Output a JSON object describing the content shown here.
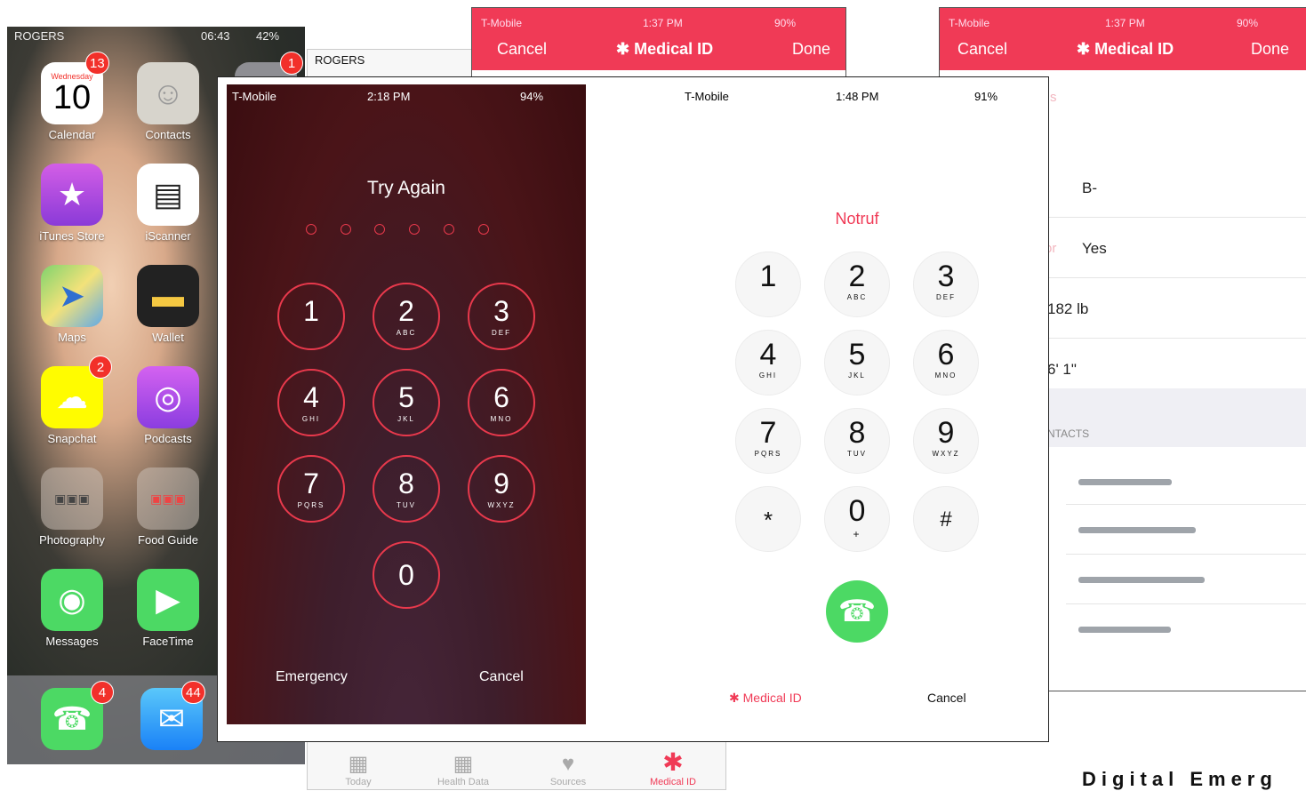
{
  "home": {
    "carrier": "ROGERS",
    "time": "06:43",
    "battery": "42%",
    "apps": [
      {
        "label": "Calendar",
        "day": "Wednesday",
        "date": "10",
        "badge": "13"
      },
      {
        "label": "Contacts",
        "badge": ""
      },
      {
        "label": "iTunes Store",
        "badge": ""
      },
      {
        "label": "iScanner",
        "badge": ""
      },
      {
        "label": "Maps",
        "badge": ""
      },
      {
        "label": "Wallet",
        "badge": ""
      },
      {
        "label": "Snapchat",
        "badge": "2"
      },
      {
        "label": "Podcasts",
        "badge": ""
      },
      {
        "label": "Photography",
        "badge": ""
      },
      {
        "label": "Food Guide",
        "badge": ""
      },
      {
        "label": "Messages",
        "badge": ""
      },
      {
        "label": "FaceTime",
        "badge": ""
      }
    ],
    "settings_badge": "1",
    "dock": [
      {
        "label": "Phone",
        "badge": "4"
      },
      {
        "label": "Mail",
        "badge": "44"
      }
    ]
  },
  "health": {
    "carrier": "ROGERS",
    "tabs": [
      "Today",
      "Health Data",
      "Sources",
      "Medical ID"
    ]
  },
  "medical_left": {
    "carrier": "T-Mobile",
    "time": "1:37 PM",
    "battery": "90%",
    "cancel": "Cancel",
    "title": "Medical ID",
    "done": "Done"
  },
  "medical_right": {
    "carrier": "T-Mobile",
    "time": "1:37 PM",
    "battery": "90%",
    "cancel": "Cancel",
    "title": "Medical ID",
    "done": "Done",
    "partial_label": "s",
    "rows": [
      {
        "label": "",
        "value": "B-"
      },
      {
        "label": "or",
        "value": "Yes"
      },
      {
        "label": "",
        "value": "182 lb"
      },
      {
        "label": "",
        "value": "6' 1\""
      }
    ],
    "section": "NTACTS"
  },
  "passcode": {
    "carrier": "T-Mobile",
    "time": "2:18 PM",
    "battery": "94%",
    "title": "Try Again",
    "keys": [
      {
        "n": "1",
        "l": ""
      },
      {
        "n": "2",
        "l": "ABC"
      },
      {
        "n": "3",
        "l": "DEF"
      },
      {
        "n": "4",
        "l": "GHI"
      },
      {
        "n": "5",
        "l": "JKL"
      },
      {
        "n": "6",
        "l": "MNO"
      },
      {
        "n": "7",
        "l": "PQRS"
      },
      {
        "n": "8",
        "l": "TUV"
      },
      {
        "n": "9",
        "l": "WXYZ"
      },
      {
        "n": "0",
        "l": ""
      }
    ],
    "emergency": "Emergency",
    "cancel": "Cancel"
  },
  "dialer": {
    "carrier": "T-Mobile",
    "time": "1:48 PM",
    "battery": "91%",
    "title": "Notruf",
    "keys": [
      {
        "n": "1",
        "l": ""
      },
      {
        "n": "2",
        "l": "ABC"
      },
      {
        "n": "3",
        "l": "DEF"
      },
      {
        "n": "4",
        "l": "GHI"
      },
      {
        "n": "5",
        "l": "JKL"
      },
      {
        "n": "6",
        "l": "MNO"
      },
      {
        "n": "7",
        "l": "PQRS"
      },
      {
        "n": "8",
        "l": "TUV"
      },
      {
        "n": "9",
        "l": "WXYZ"
      },
      {
        "n": "*",
        "l": ""
      },
      {
        "n": "0",
        "l": "+"
      },
      {
        "n": "#",
        "l": ""
      }
    ],
    "medical_id": "Medical ID",
    "cancel": "Cancel"
  },
  "caption": "Digital Emerg",
  "colors": {
    "accent_red": "#f03a56",
    "call_green": "#4cd964",
    "passcode_red": "#e8394c"
  }
}
